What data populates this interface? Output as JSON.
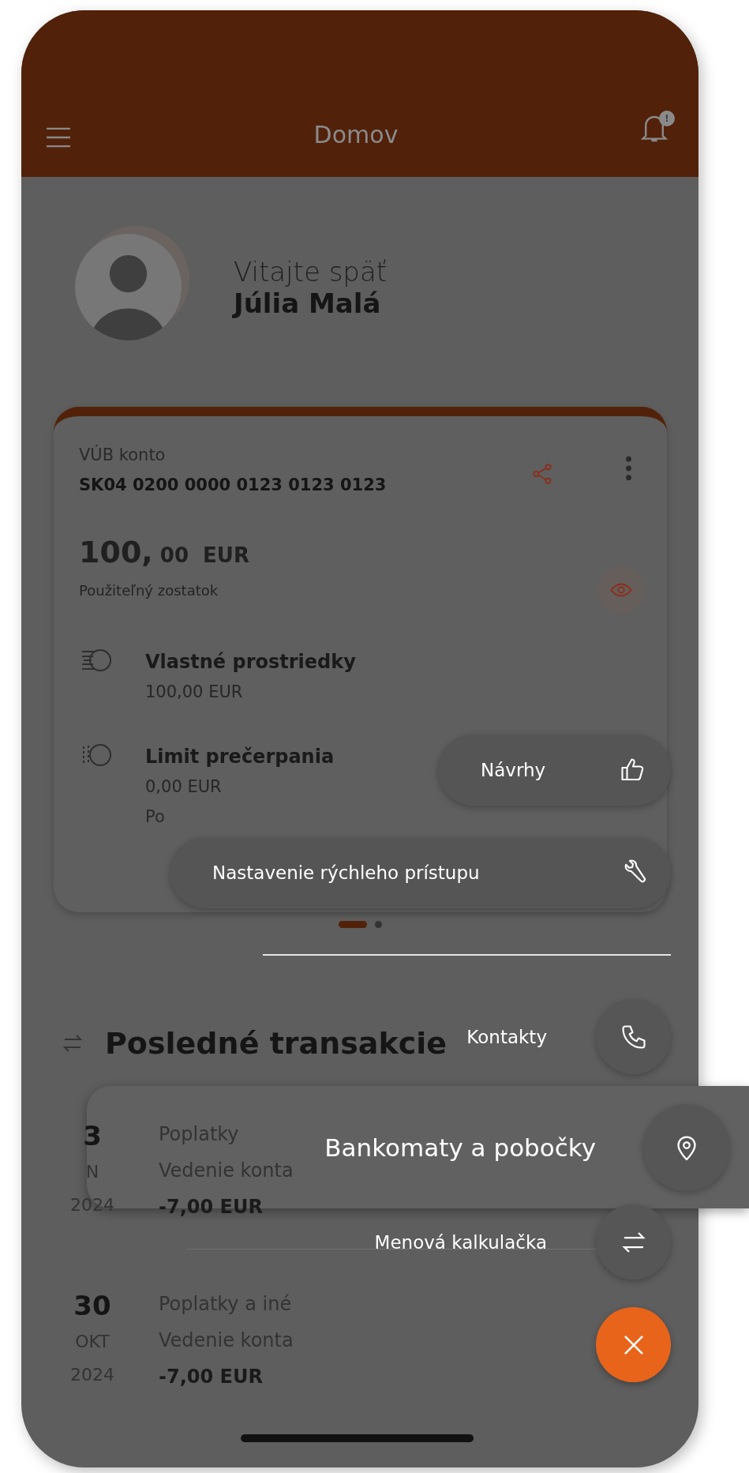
{
  "app_bar": {
    "title": "Domov",
    "notification_badge": "!"
  },
  "welcome": {
    "greeting": "Vitajte späť",
    "name": "Júlia Malá"
  },
  "account_card": {
    "name": "VÚB konto",
    "iban": "SK04 0200 0000 0123 0123 0123",
    "amount_whole": "100,",
    "amount_decimal": "00",
    "currency": "EUR",
    "balance_label": "Použiteľný zostatok",
    "items": [
      {
        "kind": "own",
        "title": "Vlastné prostriedky",
        "value": "100,00 EUR"
      },
      {
        "kind": "overdraft",
        "title": "Limit prečerpania",
        "value": "0,00 EUR",
        "note": "Po"
      }
    ]
  },
  "pager": [
    {
      "selected": true
    },
    {
      "selected": false
    }
  ],
  "transactions": {
    "title": "Posledné transakcie",
    "items": [
      {
        "day": "3",
        "month": "N",
        "year": "2024",
        "category": "Poplatky",
        "description": "Vedenie konta",
        "amount": "-7,00 EUR"
      },
      {
        "day": "30",
        "month": "OKT",
        "year": "2024",
        "category": "Poplatky a iné",
        "description": "Vedenie konta",
        "amount": "-7,00 EUR"
      }
    ]
  },
  "quick_pills": [
    {
      "kind": "suggestions",
      "label": "Návrhy"
    },
    {
      "kind": "wrench",
      "label": "Nastavenie rýchleho prístupu"
    }
  ],
  "quick_actions": [
    {
      "kind": "phone",
      "label": "Kontakty",
      "selected": false
    },
    {
      "kind": "pin",
      "label": "Bankomaty a pobočky",
      "selected": true
    },
    {
      "kind": "exchange",
      "label": "Menová kalkulačka",
      "selected": false
    }
  ]
}
